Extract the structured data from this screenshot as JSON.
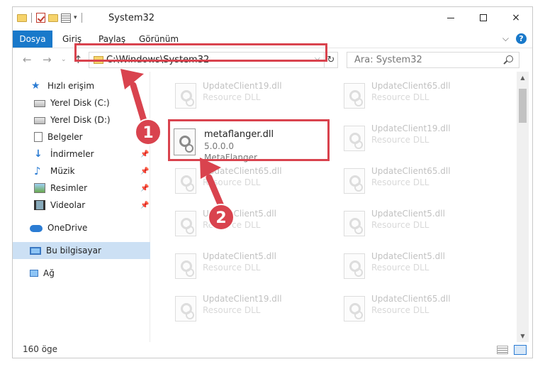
{
  "window": {
    "title": "System32",
    "controls": {
      "minimize": "minimize-icon",
      "maximize": "maximize-icon",
      "close": "×"
    }
  },
  "ribbon": {
    "tabs": [
      {
        "label": "Dosya",
        "active": true
      },
      {
        "label": "Giriş"
      },
      {
        "label": "Paylaş"
      },
      {
        "label": "Görünüm"
      }
    ],
    "help": "?",
    "collapse": "⌵"
  },
  "nav": {
    "back": "←",
    "forward": "→",
    "recent": "⌄",
    "up": "↑",
    "address": "C:\\Windows\\System32",
    "address_dropdown": "⌵",
    "refresh": "↻",
    "search_placeholder": "Ara: System32"
  },
  "sidebar": {
    "items": [
      {
        "label": "Hızlı erişim",
        "icon": "star-icon"
      },
      {
        "label": "Yerel Disk (C:)",
        "icon": "drive-icon",
        "pinned": true
      },
      {
        "label": "Yerel Disk (D:)",
        "icon": "drive-icon",
        "pinned": true
      },
      {
        "label": "Belgeler",
        "icon": "documents-icon",
        "pinned": true
      },
      {
        "label": "İndirmeler",
        "icon": "download-icon",
        "pinned": true
      },
      {
        "label": "Müzik",
        "icon": "music-icon",
        "pinned": true
      },
      {
        "label": "Resimler",
        "icon": "pictures-icon",
        "pinned": true
      },
      {
        "label": "Videolar",
        "icon": "videos-icon",
        "pinned": true
      },
      {
        "label": "OneDrive",
        "icon": "onedrive-icon"
      },
      {
        "label": "Bu bilgisayar",
        "icon": "this-pc-icon",
        "selected": true
      },
      {
        "label": "Ağ",
        "icon": "network-icon"
      }
    ],
    "pin_glyph": "📌"
  },
  "files": {
    "background": [
      {
        "name": "UpdateClient19.dll",
        "type": "Resource DLL"
      },
      {
        "name": "UpdateClient65.dll",
        "type": "Resource DLL"
      },
      {
        "name": "UpdateClient19.dll",
        "type": "Resource DLL"
      },
      {
        "name": "UpdateClient65.dll",
        "type": "Resource DLL"
      },
      {
        "name": "UpdateClient65.dll",
        "type": "Resource DLL"
      },
      {
        "name": "UpdateClient5.dll",
        "type": "Resource DLL"
      },
      {
        "name": "UpdateClient5.dll",
        "type": "Resource DLL"
      },
      {
        "name": "UpdateClient5.dll",
        "type": "Resource DLL"
      },
      {
        "name": "UpdateClient5.dll",
        "type": "Resource DLL"
      },
      {
        "name": "UpdateClient19.dll",
        "type": "Resource DLL"
      },
      {
        "name": "UpdateClient65.dll",
        "type": "Resource DLL"
      }
    ],
    "featured": {
      "name": "metaflanger.dll",
      "version": "5.0.0.0",
      "description": "MetaFlanger"
    }
  },
  "status": {
    "item_count": "160 öge"
  },
  "annotations": {
    "step1": "1",
    "step2": "2",
    "highlight_color": "#d9434e"
  }
}
